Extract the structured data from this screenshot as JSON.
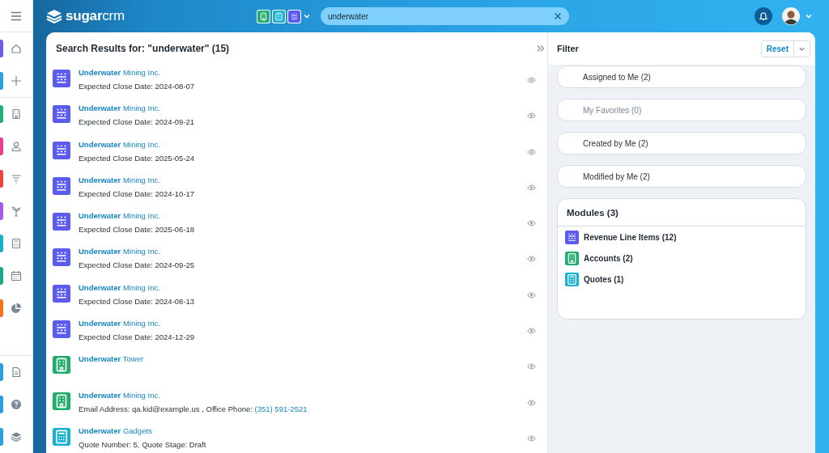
{
  "sidebar": {
    "groups": [
      {
        "items": [
          {
            "color": "#6b5cf0"
          },
          {
            "color": "#2a9fe0"
          }
        ]
      },
      {
        "items": [
          {
            "color": "#1fb07a"
          },
          {
            "color": "#ec3d8f"
          },
          {
            "color": "#f0423c"
          },
          {
            "color": "#a25cf0"
          },
          {
            "color": "#17b0c8"
          },
          {
            "color": "#1aa88a"
          },
          {
            "color": "#f97316"
          }
        ]
      },
      {
        "items": [
          {
            "color": "#2a9fe0"
          },
          {
            "color": "#2a9fe0"
          },
          {
            "color": "#2a9fe0"
          }
        ]
      }
    ]
  },
  "topbar": {
    "logo": "**sugar**crm",
    "module_shortcuts": [
      {
        "color": "#1fad6b"
      },
      {
        "color": "#17b0d0"
      },
      {
        "color": "#5b5bf0"
      }
    ],
    "search": {
      "value": "underwater"
    }
  },
  "results": {
    "title": "Search Results for: \"underwater\" (15)",
    "items": [
      {
        "kind": "revenue_line_item",
        "title": "**Underwater** Mining Inc.",
        "detail": "Expected Close Date: 2024-08-07"
      },
      {
        "kind": "revenue_line_item",
        "title": "**Underwater** Mining Inc.",
        "detail": "Expected Close Date: 2024-09-21"
      },
      {
        "kind": "revenue_line_item",
        "title": "**Underwater** Mining Inc.",
        "detail": "Expected Close Date: 2025-05-24"
      },
      {
        "kind": "revenue_line_item",
        "title": "**Underwater** Mining Inc.",
        "detail": "Expected Close Date: 2024-10-17"
      },
      {
        "kind": "revenue_line_item",
        "title": "**Underwater** Mining Inc.",
        "detail": "Expected Close Date: 2025-06-18"
      },
      {
        "kind": "revenue_line_item",
        "title": "**Underwater** Mining Inc.",
        "detail": "Expected Close Date: 2024-09-25"
      },
      {
        "kind": "revenue_line_item",
        "title": "**Underwater** Mining Inc.",
        "detail": "Expected Close Date: 2024-08-13"
      },
      {
        "kind": "revenue_line_item",
        "title": "**Underwater** Mining Inc.",
        "detail": "Expected Close Date: 2024-12-29"
      },
      {
        "kind": "account",
        "title": "**Underwater** Tower"
      },
      {
        "kind": "account",
        "title": "**Underwater** Mining Inc.",
        "detail": "Email Address: qa.kid@example.us , Office Phone: ",
        "link": "(351) 591-2521"
      },
      {
        "kind": "quote",
        "title": "**Underwater** Gadgets",
        "detail": "Quote Number: 5, Quote Stage: Draft"
      }
    ]
  },
  "filter": {
    "title": "Filter",
    "reset": "Reset",
    "options": [
      {
        "label": "Assigned to Me (2)",
        "disabled": false
      },
      {
        "label": "My Favorites (0)",
        "disabled": true
      },
      {
        "label": "Created by Me (2)",
        "disabled": false
      },
      {
        "label": "Modified by Me (2)",
        "disabled": false
      }
    ],
    "modules": {
      "title": "Modules (3)",
      "items": [
        {
          "kind": "revenue_line_item",
          "label": "Revenue Line Items (12)"
        },
        {
          "kind": "account",
          "label": "Accounts (2)"
        },
        {
          "kind": "quote",
          "label": "Quotes (1)"
        }
      ]
    }
  }
}
